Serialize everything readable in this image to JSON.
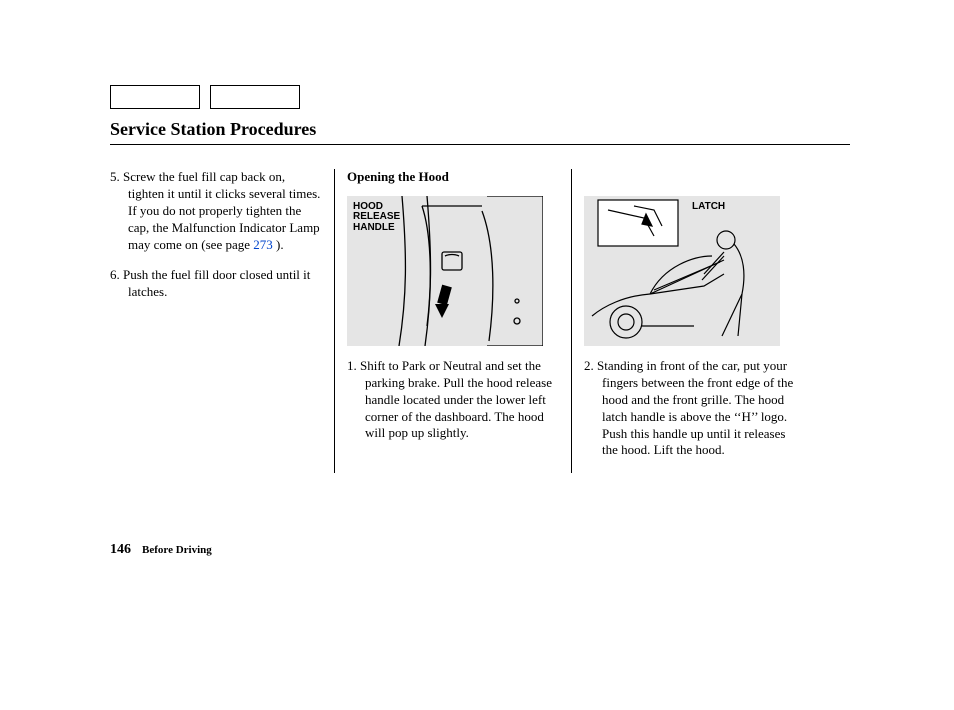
{
  "header": {
    "section_title": "Service Station Procedures"
  },
  "column1": {
    "items": [
      {
        "marker": "5.",
        "text_before_link": "Screw the fuel fill cap back on, tighten it until it clicks several times. If you do not properly tighten the cap, the Malfunction Indicator Lamp may come on (see page ",
        "link_text": "273",
        "text_after_link": " )."
      },
      {
        "marker": "6.",
        "text": "Push the fuel fill door closed until it latches."
      }
    ]
  },
  "column2": {
    "heading": "Opening the Hood",
    "figure_label": "HOOD\nRELEASE\nHANDLE",
    "items": [
      {
        "marker": "1.",
        "text": "Shift to Park or Neutral and set the parking brake. Pull the hood release handle located under the lower left corner of the dashboard. The hood will pop up slightly."
      }
    ]
  },
  "column3": {
    "figure_label": "LATCH",
    "items": [
      {
        "marker": "2.",
        "text": "Standing in front of the car, put your fingers between the front edge of the hood and the front grille. The hood latch handle is above the ‘‘H’’ logo. Push this handle up until it releases the hood. Lift the hood."
      }
    ]
  },
  "footer": {
    "page_number": "146",
    "section_name": "Before Driving"
  }
}
